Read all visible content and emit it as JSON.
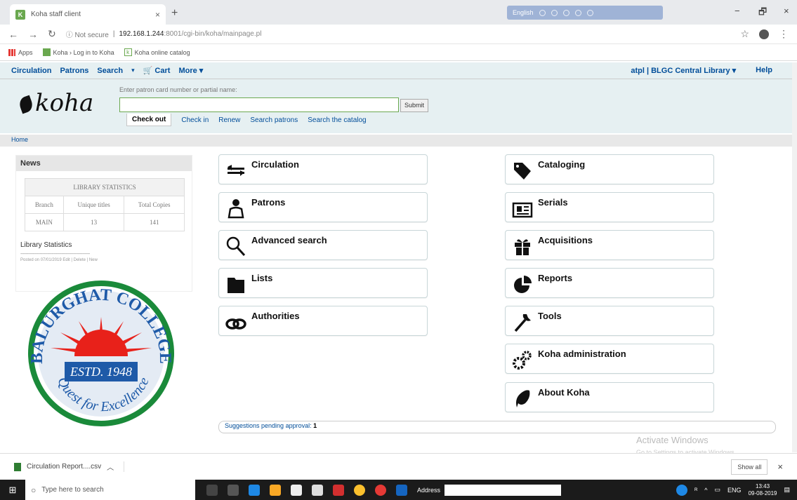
{
  "browser": {
    "tab_title": "Koha staff client",
    "tab_close": "×",
    "new_tab": "+",
    "ext_text": "English",
    "window_min": "−",
    "window_restore": "🗗",
    "window_close": "×",
    "not_secure": "ⓘ Not secure",
    "url_host": "192.168.1.244",
    "url_path": ":8001/cgi-bin/koha/mainpage.pl",
    "bookmarks": [
      "Apps",
      "Koha › Log in to Koha",
      "Koha online catalog"
    ]
  },
  "koha_nav": {
    "items": [
      "Circulation",
      "Patrons",
      "Search",
      "Cart",
      "More"
    ],
    "user": "atpl",
    "library": "BLGC Central Library",
    "help": "Help"
  },
  "header": {
    "logo": "koha",
    "prompt": "Enter patron card number or partial name:",
    "submit": "Submit",
    "tabs": [
      "Check out",
      "Check in",
      "Renew",
      "Search patrons",
      "Search the catalog"
    ]
  },
  "breadcrumb": "Home",
  "news": {
    "title": "News",
    "table_caption": "LIBRARY STATISTICS",
    "headers": [
      "Branch",
      "Unique titles",
      "Total Copies"
    ],
    "row": [
      "MAIN",
      "13",
      "141"
    ],
    "library_stats": "Library Statistics",
    "dashes": "------------------------------------------------------",
    "posted": "Posted on 07/01/2019 Edit | Delete | New"
  },
  "seal": {
    "top_text": "BALURGHAT COLLEGE",
    "estd": "ESTD. 1948",
    "motto": "Quest for Excellence",
    "colors": {
      "ring": "#1e5aa8",
      "sun": "#e8211a",
      "rays": "#e8211a",
      "scallop": "#1a8a3a"
    }
  },
  "modules_left": [
    {
      "label": "Circulation",
      "icon": "arrows-icon"
    },
    {
      "label": "Patrons",
      "icon": "user-icon"
    },
    {
      "label": "Advanced search",
      "icon": "search-icon"
    },
    {
      "label": "Lists",
      "icon": "folder-icon"
    },
    {
      "label": "Authorities",
      "icon": "link-icon"
    }
  ],
  "modules_right": [
    {
      "label": "Cataloging",
      "icon": "tag-icon"
    },
    {
      "label": "Serials",
      "icon": "newspaper-icon"
    },
    {
      "label": "Acquisitions",
      "icon": "gift-icon"
    },
    {
      "label": "Reports",
      "icon": "pie-chart-icon"
    },
    {
      "label": "Tools",
      "icon": "wrench-icon"
    },
    {
      "label": "Koha administration",
      "icon": "gears-icon"
    },
    {
      "label": "About Koha",
      "icon": "leaf-icon"
    }
  ],
  "suggestions": {
    "label": "Suggestions pending approval:",
    "count": "1"
  },
  "activate": {
    "title": "Activate Windows",
    "sub": "Go to Settings to activate Windows."
  },
  "download": {
    "file": "Circulation Report....csv",
    "show_all": "Show all",
    "close": "×"
  },
  "taskbar": {
    "search_placeholder": "Type here to search",
    "address_label": "Address",
    "lang": "ENG",
    "time": "13:43",
    "date": "09-08-2019"
  }
}
